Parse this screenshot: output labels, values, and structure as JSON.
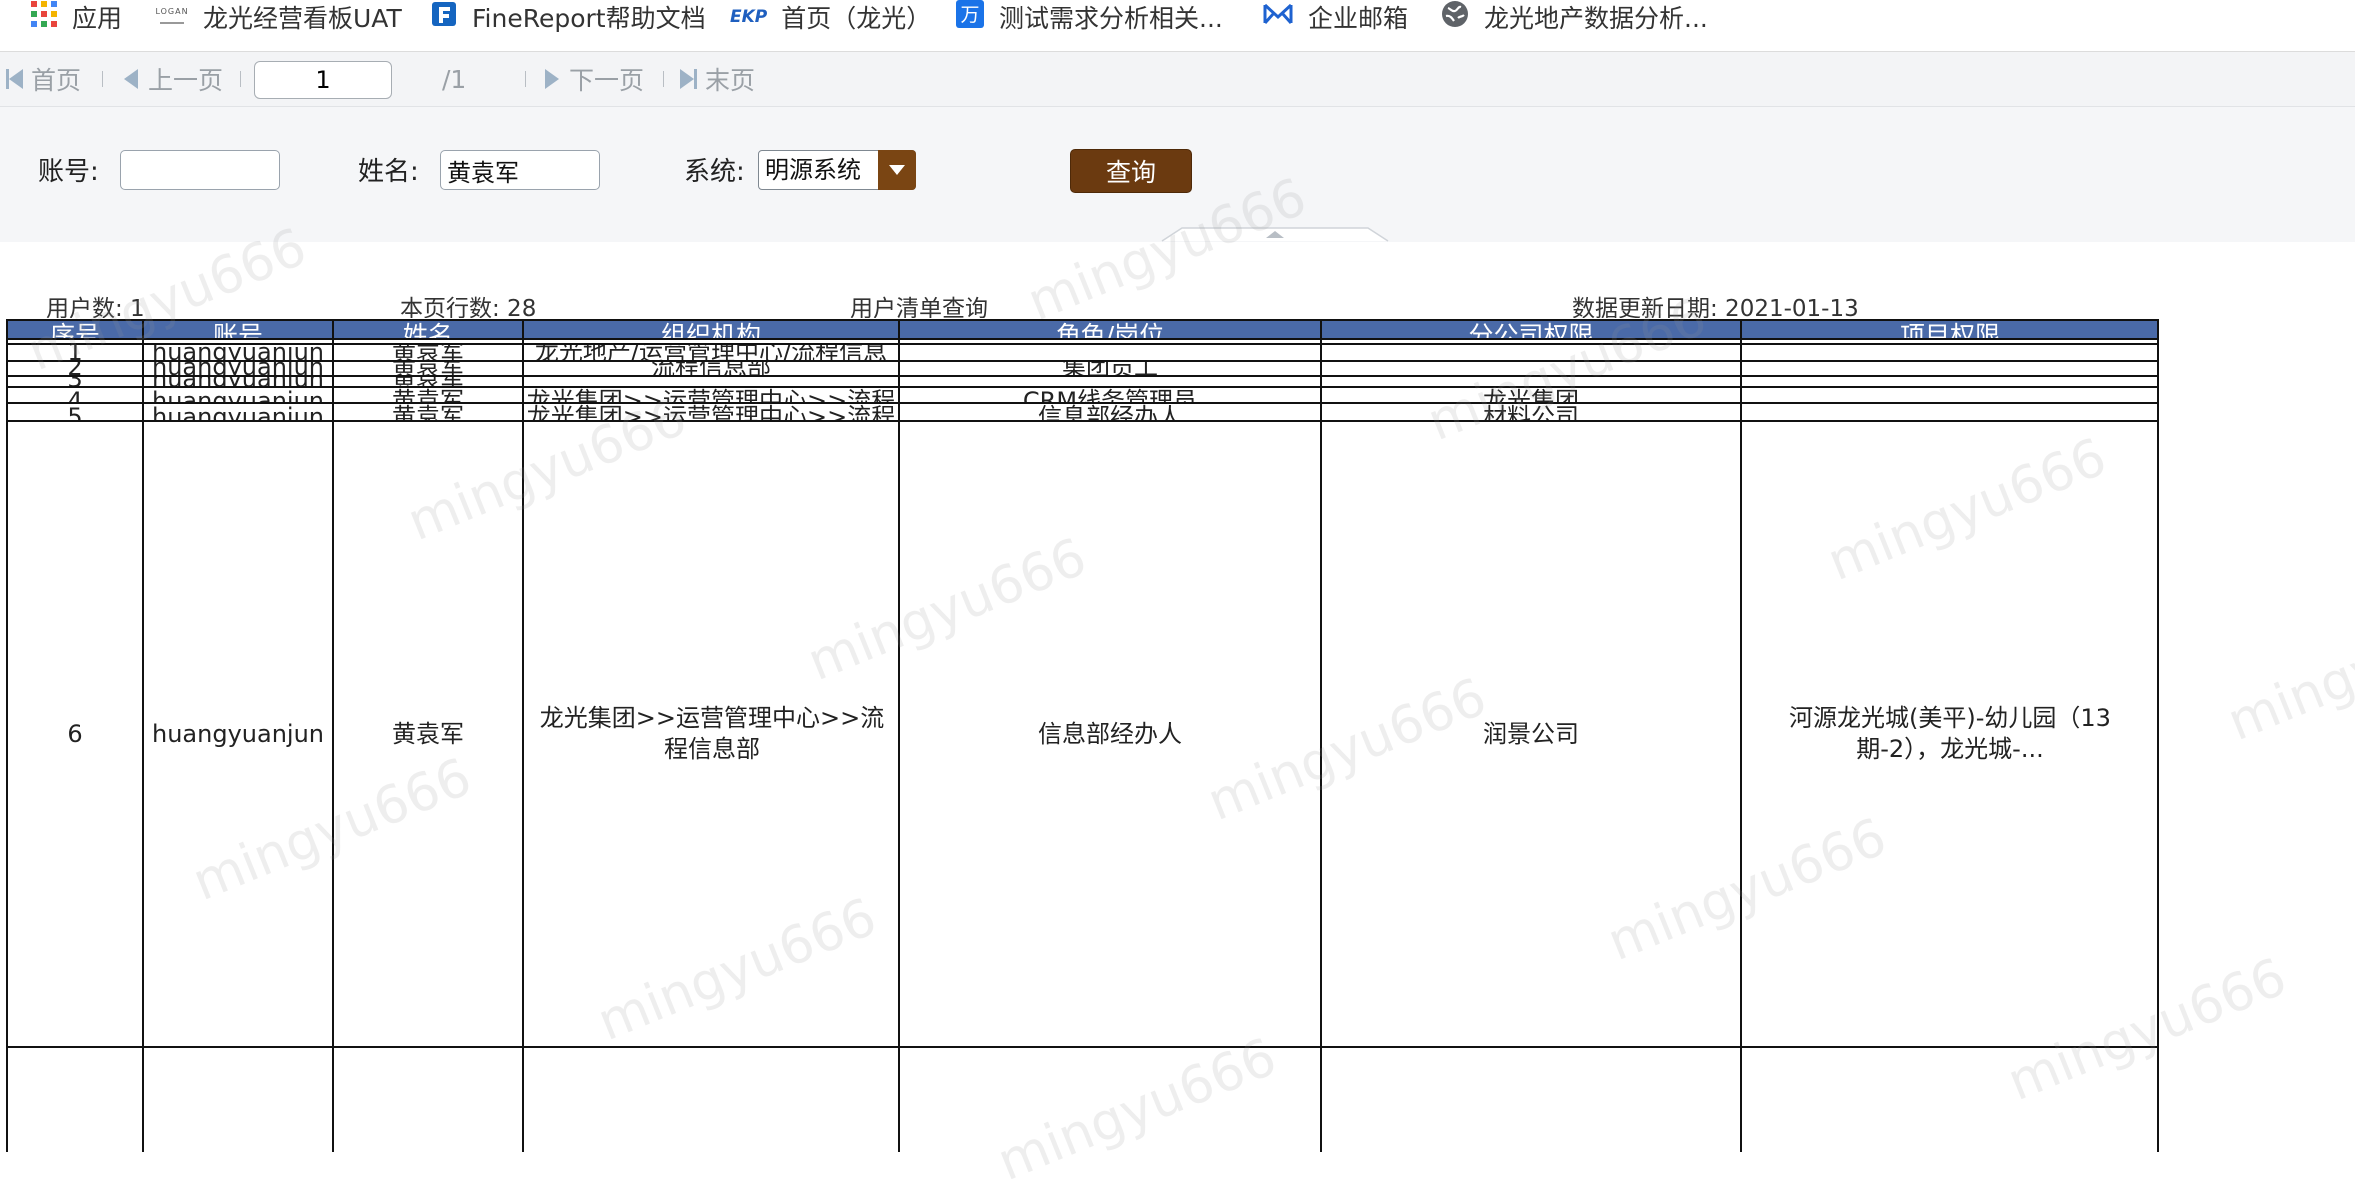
{
  "bookmarks": [
    {
      "label": "应用",
      "icon": "apps-grid-icon"
    },
    {
      "label": "龙光经营看板UAT",
      "icon": "logan-logo-icon"
    },
    {
      "label": "FineReport帮助文档",
      "icon": "finereport-icon"
    },
    {
      "label": "首页（龙光）",
      "icon": "ekp-icon"
    },
    {
      "label": "测试需求分析相关...",
      "icon": "wan-icon"
    },
    {
      "label": "企业邮箱",
      "icon": "mail-icon"
    },
    {
      "label": "龙光地产数据分析...",
      "icon": "globe-icon"
    }
  ],
  "logo_text": "LOGAN",
  "pager": {
    "first": "首页",
    "prev": "上一页",
    "page": "1",
    "total": "/1",
    "next": "下一页",
    "last": "末页"
  },
  "filter": {
    "account_label": "账号:",
    "account_value": "",
    "name_label": "姓名:",
    "name_value": "黄袁军",
    "system_label": "系统:",
    "system_value": "明源系统",
    "query_label": "查询"
  },
  "meta": {
    "user_count": "用户数:  1",
    "row_count": "本页行数:  28",
    "title": "用户清单查询",
    "update_date": "数据更新日期:  2021-01-13"
  },
  "columns": [
    "序号",
    "账号",
    "姓名",
    "组织机构",
    "角色/岗位",
    "分公司权限",
    "项目权限"
  ],
  "rows": [
    {
      "no": "1",
      "account": "huangyuanjun",
      "name": "黄袁军",
      "org": "龙光地产/运营管理中心/流程信息",
      "role": "",
      "company": "",
      "project": ""
    },
    {
      "no": "2",
      "account": "huangyuanjun",
      "name": "黄袁军",
      "org": "流程信息部",
      "role": "集团员工",
      "company": "",
      "project": ""
    },
    {
      "no": "3",
      "account": "huangyuanjun",
      "name": "黄袁军",
      "org": "",
      "role": "",
      "company": "",
      "project": ""
    },
    {
      "no": "4",
      "account": "huangyuanjun",
      "name": "黄袁军",
      "org": "龙光集团>>运营管理中心>>流程",
      "role": "CRM线务管理员",
      "company": "龙光集团",
      "project": ""
    },
    {
      "no": "5",
      "account": "huangyuanjun",
      "name": "黄袁军",
      "org": "龙光集团>>运营管理中心>>流程",
      "role": "信息部经办人",
      "company": "材料公司",
      "project": ""
    },
    {
      "no": "6",
      "account": "huangyuanjun",
      "name": "黄袁军",
      "org": "龙光集团>>运营管理中心>>流程信息部",
      "role": "信息部经办人",
      "company": "润景公司",
      "project": "河源龙光城(美平)-幼儿园（13期-2），龙光城-..."
    }
  ],
  "watermark": "mingyu666"
}
